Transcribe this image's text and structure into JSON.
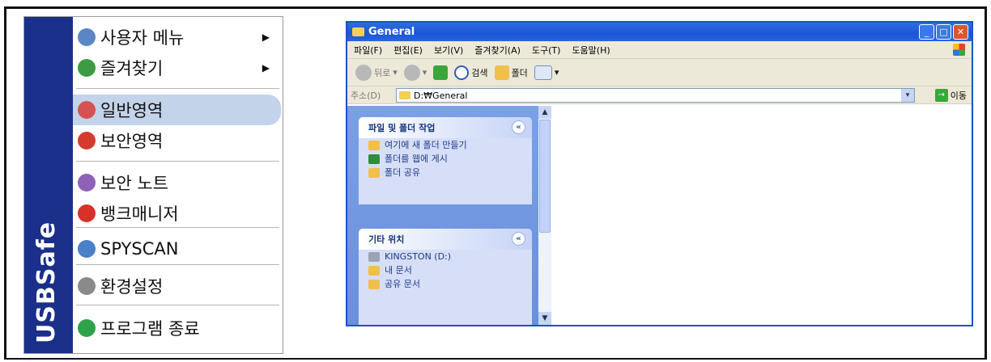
{
  "menu": {
    "brand": "USBSafe",
    "items": [
      {
        "label": "사용자 메뉴",
        "icon": "users-icon",
        "color": "#5b86c5",
        "has_submenu": true
      },
      {
        "label": "즐겨찾기",
        "icon": "favorites-icon",
        "color": "#3c9b43",
        "has_submenu": true
      },
      {
        "label": "일반영역",
        "icon": "general-area-icon",
        "color": "#d65252",
        "selected": true
      },
      {
        "label": "보안영역",
        "icon": "secure-area-icon",
        "color": "#d43b2f"
      },
      {
        "label": "보안 노트",
        "icon": "note-icon",
        "color": "#8e62b7"
      },
      {
        "label": "뱅크매니저",
        "icon": "bank-lock-icon",
        "color": "#d7312a"
      },
      {
        "label": "SPYSCAN",
        "icon": "magnifier-icon",
        "color": "#4a7fc9"
      },
      {
        "label": "환경설정",
        "icon": "settings-icon",
        "color": "#8a8a8a"
      },
      {
        "label": "프로그램 종료",
        "icon": "power-icon",
        "color": "#2ea34a"
      }
    ],
    "arrow": "▶"
  },
  "explorer": {
    "title": "General",
    "controls": {
      "minimize": "_",
      "maximize": "□",
      "close": "✕"
    },
    "menubar": [
      "파일(F)",
      "편집(E)",
      "보기(V)",
      "즐겨찾기(A)",
      "도구(T)",
      "도움말(H)"
    ],
    "toolbar": {
      "back": "뒤로",
      "search": "검색",
      "folders": "폴더"
    },
    "address": {
      "label": "주소(D)",
      "value": "D:₩General",
      "go": "이동",
      "go_icon": "→",
      "dropdown": "▾"
    },
    "taskpane": {
      "panel1": {
        "title": "파일 및 폴더 작업",
        "chevron": "«",
        "links": [
          {
            "label": "여기에 새 폴더 만들기",
            "icon": "new-folder-icon",
            "color": "#f0c04a"
          },
          {
            "label": "폴더를 웹에 게시",
            "icon": "globe-icon",
            "color": "#2f8d3c"
          },
          {
            "label": "폴더 공유",
            "icon": "share-folder-icon",
            "color": "#f0c04a"
          }
        ]
      },
      "panel2": {
        "title": "기타 위치",
        "chevron": "«",
        "links": [
          {
            "label": "KINGSTON (D:)",
            "icon": "drive-icon",
            "color": "#9aa4b5"
          },
          {
            "label": "내 문서",
            "icon": "my-documents-icon",
            "color": "#f0c04a"
          },
          {
            "label": "공유 문서",
            "icon": "shared-documents-icon",
            "color": "#f0c04a"
          }
        ]
      }
    },
    "scroll": {
      "up": "▲",
      "down": "▼"
    }
  }
}
